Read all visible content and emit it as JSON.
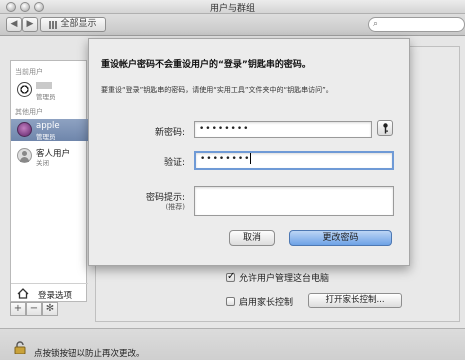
{
  "window": {
    "title": "用户与群组"
  },
  "toolbar": {
    "back": "◀",
    "forward": "▶",
    "show_all": "全部显示",
    "search_placeholder": ""
  },
  "sidebar": {
    "current_user_header": "当前用户",
    "current_user": {
      "role": "管理员"
    },
    "other_users_header": "其他用户",
    "users": [
      {
        "name": "apple",
        "role": "管理员",
        "selected": true
      },
      {
        "name": "客人用户",
        "role": "关闭",
        "selected": false
      }
    ],
    "login_options": "登录选项",
    "controls": {
      "add": "+",
      "remove": "−",
      "settings": "✻"
    }
  },
  "main": {
    "allow_admin_label": "允许用户管理这台电脑",
    "allow_admin_checked": true,
    "parental_controls_label": "启用家长控制",
    "parental_controls_checked": false,
    "open_parental_button": "打开家长控制..."
  },
  "footer": {
    "lock_text": "点按锁按钮以防止再次更改。"
  },
  "dialog": {
    "title": "重设帐户密码不会重设用户的“登录”钥匙串的密码。",
    "description": "要重设“登录”钥匙串的密码，请使用“实用工具”文件夹中的“钥匙串访问”。",
    "new_password_label": "新密码:",
    "new_password_value": "••••••••",
    "verify_label": "验证:",
    "verify_value": "••••••••",
    "hint_label": "密码提示:",
    "hint_sublabel": "(推荐)",
    "hint_value": "",
    "cancel_button": "取消",
    "change_button": "更改密码"
  }
}
